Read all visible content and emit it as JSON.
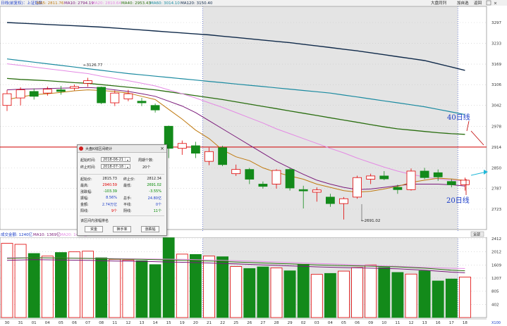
{
  "indicator_bar": {
    "symbol": "日线(前复权)：上证指数",
    "ma5": "MA5: 2811.76",
    "ma10": "MA10: 2794.19",
    "ma20": "MA20: 2810.64",
    "ma40": "MA40: 2953.43",
    "ma60": "MA60: 3014.10",
    "ma120": "MA120: 3150.40"
  },
  "toolbar": {
    "zoom_btn": "大盘同列",
    "add_btn": "加自选",
    "back_btn": "返回"
  },
  "volume_bar": {
    "vol": "成交金额: 1240亿",
    "ma10": "MA10: 1369亿",
    "ma20": "MA20: 1498亿"
  },
  "annotations": {
    "ma40_label": "40日线",
    "ma20_label": "20日线",
    "high_label": "3126.77",
    "low_label": "2691.02"
  },
  "colors": {
    "up": "#e00000",
    "down": "#138a1a",
    "ma5": "#c07a10",
    "ma10": "#7a1a7a",
    "ma20": "#e48ae4",
    "ma40": "#2a6e10",
    "ma60": "#1a8aa0",
    "ma120": "#102a4a",
    "highlight": "#e4e4e4",
    "hline": "#d00000"
  },
  "dialog": {
    "title": "大盘K线区间统计",
    "start_label": "起始时间:",
    "start_value": "2018-06-21",
    "end_label": "终止时间:",
    "end_value": "2018-07-18",
    "period_label": "周期个数:",
    "period_value": "20个",
    "open_label": "起始价:",
    "open_value": "2815.73",
    "close_label": "终止价:",
    "close_value": "2812.34",
    "high_label": "最高:",
    "high_value": "2940.59",
    "low_label": "最低:",
    "low_value": "2691.02",
    "chg_label": "涨跌幅:",
    "chg_value": "-103.39",
    "pct_value": "-3.55%",
    "amp_label": "振幅:",
    "amp_value": "8.56%",
    "turn_label": "总手:",
    "turn_value": "24.80亿",
    "amt_label": "金额:",
    "amt_value": "2.74万亿",
    "flat_label": "平线:",
    "flat_value": "0个",
    "yang_label": "阳线:",
    "yang_value": "9个",
    "yin_label": "阴线:",
    "yin_value": "11个",
    "rank_label": "该区间内涨幅排名",
    "btn_fund": "资金",
    "btn_turnover": "换手率",
    "btn_rise": "涨跌幅"
  },
  "chart_data": {
    "type": "candlestick",
    "price_axis": [
      3297,
      3233,
      3169,
      3106,
      3042,
      2978,
      2914,
      2850,
      2787,
      2723
    ],
    "volume_axis": [
      2412,
      2012,
      1609,
      1207,
      805,
      402
    ],
    "volume_unit_label": "X100",
    "right_tab": "全部",
    "x_labels": [
      "30",
      "31",
      "01",
      "04",
      "05",
      "06",
      "07",
      "08",
      "11",
      "12",
      "13",
      "14",
      "15",
      "19",
      "20",
      "21",
      "22",
      "25",
      "26",
      "27",
      "28",
      "29",
      "02",
      "03",
      "04",
      "05",
      "06",
      "09",
      "10",
      "11",
      "12",
      "13",
      "16",
      "17",
      "18"
    ],
    "highlight_range": [
      "21",
      "17"
    ],
    "hline": 2914,
    "candles": [
      {
        "o": 3042,
        "c": 3078,
        "h": 3090,
        "l": 3025
      },
      {
        "o": 3065,
        "c": 3090,
        "h": 3098,
        "l": 3042
      },
      {
        "o": 3085,
        "c": 3070,
        "h": 3094,
        "l": 3060
      },
      {
        "o": 3080,
        "c": 3092,
        "h": 3100,
        "l": 3072
      },
      {
        "o": 3090,
        "c": 3085,
        "h": 3102,
        "l": 3075
      },
      {
        "o": 3095,
        "c": 3100,
        "h": 3106,
        "l": 3088
      },
      {
        "o": 3110,
        "c": 3118,
        "h": 3127,
        "l": 3100
      },
      {
        "o": 3098,
        "c": 3050,
        "h": 3100,
        "l": 3046
      },
      {
        "o": 3050,
        "c": 3080,
        "h": 3088,
        "l": 3040
      },
      {
        "o": 3062,
        "c": 3078,
        "h": 3090,
        "l": 3055
      },
      {
        "o": 3055,
        "c": 3050,
        "h": 3065,
        "l": 3040
      },
      {
        "o": 3042,
        "c": 3028,
        "h": 3048,
        "l": 3020
      },
      {
        "o": 2978,
        "c": 2910,
        "h": 2980,
        "l": 2880
      },
      {
        "o": 2910,
        "c": 2925,
        "h": 2934,
        "l": 2890
      },
      {
        "o": 2918,
        "c": 2895,
        "h": 2930,
        "l": 2880
      },
      {
        "o": 2870,
        "c": 2900,
        "h": 2912,
        "l": 2858
      },
      {
        "o": 2912,
        "c": 2860,
        "h": 2918,
        "l": 2855
      },
      {
        "o": 2832,
        "c": 2845,
        "h": 2860,
        "l": 2825
      },
      {
        "o": 2845,
        "c": 2815,
        "h": 2850,
        "l": 2800
      },
      {
        "o": 2800,
        "c": 2793,
        "h": 2808,
        "l": 2786
      },
      {
        "o": 2800,
        "c": 2842,
        "h": 2846,
        "l": 2786
      },
      {
        "o": 2845,
        "c": 2788,
        "h": 2850,
        "l": 2780
      },
      {
        "o": 2783,
        "c": 2779,
        "h": 2795,
        "l": 2725
      },
      {
        "o": 2775,
        "c": 2782,
        "h": 2790,
        "l": 2746
      },
      {
        "o": 2760,
        "c": 2740,
        "h": 2770,
        "l": 2730
      },
      {
        "o": 2740,
        "c": 2755,
        "h": 2760,
        "l": 2691
      },
      {
        "o": 2760,
        "c": 2820,
        "h": 2826,
        "l": 2755
      },
      {
        "o": 2815,
        "c": 2825,
        "h": 2832,
        "l": 2800
      },
      {
        "o": 2825,
        "c": 2816,
        "h": 2840,
        "l": 2812
      },
      {
        "o": 2790,
        "c": 2783,
        "h": 2798,
        "l": 2770
      },
      {
        "o": 2783,
        "c": 2840,
        "h": 2848,
        "l": 2780
      },
      {
        "o": 2840,
        "c": 2820,
        "h": 2850,
        "l": 2815
      },
      {
        "o": 2835,
        "c": 2822,
        "h": 2845,
        "l": 2810
      },
      {
        "o": 2808,
        "c": 2798,
        "h": 2815,
        "l": 2790
      },
      {
        "o": 2798,
        "c": 2812,
        "h": 2820,
        "l": 2780
      }
    ],
    "volumes": [
      2270,
      2240,
      1960,
      1880,
      1990,
      2010,
      2030,
      1830,
      1780,
      1760,
      1740,
      1620,
      2440,
      1940,
      1930,
      1880,
      1860,
      1560,
      1500,
      1550,
      1520,
      1430,
      1630,
      1320,
      1350,
      1420,
      1530,
      1610,
      1530,
      1380,
      1330,
      1430,
      1120,
      1180,
      1240
    ],
    "ma5": [
      3060,
      3068,
      3075,
      3078,
      3082,
      3087,
      3090,
      3088,
      3085,
      3080,
      3070,
      3060,
      3030,
      3000,
      2966,
      2940,
      2905,
      2884,
      2872,
      2850,
      2836,
      2825,
      2815,
      2800,
      2790,
      2780,
      2775,
      2778,
      2785,
      2793,
      2805,
      2812,
      2818,
      2816,
      2811
    ],
    "ma10": [
      3090,
      3092,
      3093,
      3094,
      3095,
      3096,
      3097,
      3095,
      3090,
      3085,
      3078,
      3070,
      3055,
      3040,
      3020,
      2995,
      2970,
      2945,
      2920,
      2895,
      2870,
      2850,
      2830,
      2812,
      2800,
      2790,
      2783,
      2785,
      2790,
      2795,
      2800,
      2800,
      2800,
      2798,
      2794
    ],
    "ma20": [
      3170,
      3165,
      3160,
      3155,
      3150,
      3145,
      3140,
      3132,
      3125,
      3118,
      3110,
      3102,
      3090,
      3078,
      3065,
      3050,
      3036,
      3020,
      3004,
      2988,
      2970,
      2955,
      2940,
      2925,
      2910,
      2896,
      2880,
      2866,
      2852,
      2840,
      2830,
      2822,
      2816,
      2812,
      2810
    ],
    "ma40": [
      3125,
      3122,
      3120,
      3118,
      3115,
      3112,
      3110,
      3106,
      3102,
      3098,
      3094,
      3090,
      3084,
      3078,
      3072,
      3066,
      3060,
      3053,
      3046,
      3039,
      3032,
      3025,
      3018,
      3011,
      3004,
      2997,
      2990,
      2983,
      2976,
      2970,
      2966,
      2962,
      2958,
      2955,
      2953
    ],
    "ma60": [
      3185,
      3180,
      3175,
      3170,
      3165,
      3160,
      3155,
      3150,
      3145,
      3140,
      3136,
      3132,
      3128,
      3124,
      3120,
      3116,
      3112,
      3108,
      3104,
      3100,
      3096,
      3092,
      3088,
      3084,
      3080,
      3074,
      3068,
      3062,
      3056,
      3050,
      3044,
      3038,
      3030,
      3022,
      3014
    ],
    "ma120": [
      3297,
      3295,
      3293,
      3291,
      3289,
      3287,
      3285,
      3283,
      3280,
      3277,
      3274,
      3271,
      3268,
      3265,
      3262,
      3259,
      3255,
      3251,
      3247,
      3243,
      3239,
      3235,
      3230,
      3225,
      3220,
      3215,
      3210,
      3204,
      3198,
      3192,
      3186,
      3180,
      3170,
      3160,
      3150
    ],
    "vol_ma10": [
      1750,
      1760,
      1770,
      1765,
      1760,
      1755,
      1750,
      1740,
      1730,
      1725,
      1720,
      1710,
      1700,
      1690,
      1680,
      1670,
      1655,
      1640,
      1625,
      1610,
      1595,
      1580,
      1565,
      1550,
      1540,
      1530,
      1520,
      1510,
      1500,
      1490,
      1470,
      1450,
      1420,
      1390,
      1369
    ],
    "vol_ma20": [
      1830,
      1830,
      1828,
      1825,
      1822,
      1820,
      1815,
      1810,
      1805,
      1800,
      1795,
      1790,
      1785,
      1780,
      1770,
      1760,
      1750,
      1740,
      1730,
      1715,
      1700,
      1685,
      1670,
      1655,
      1640,
      1625,
      1610,
      1595,
      1580,
      1565,
      1550,
      1535,
      1520,
      1508,
      1498
    ]
  }
}
